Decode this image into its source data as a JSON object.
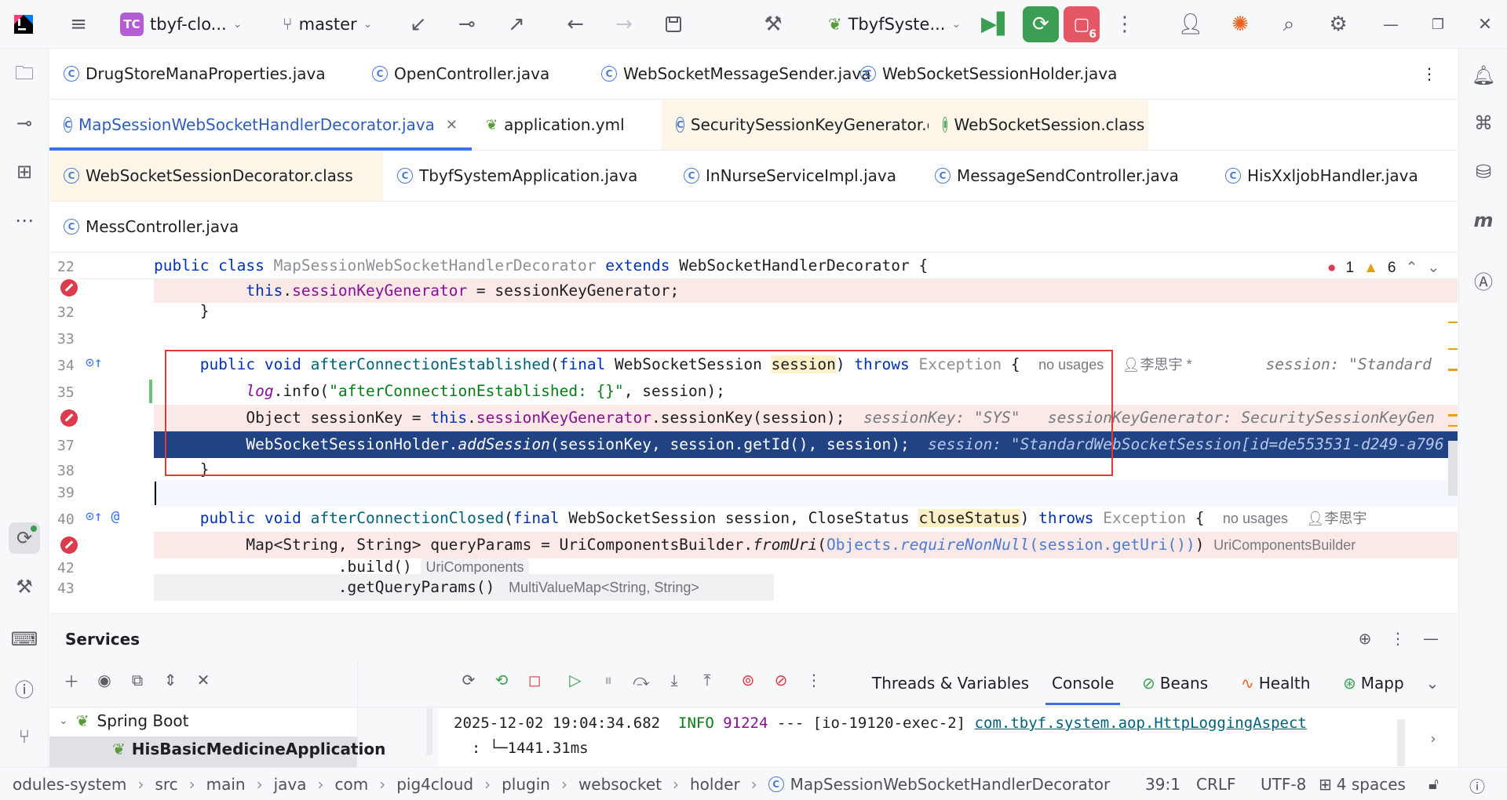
{
  "titlebar": {
    "project_badge": "TC",
    "project_name": "tbyf-clo...",
    "branch": "master",
    "run_config": "TbyfSyste...",
    "notification_count": "6"
  },
  "tabs": {
    "row1": [
      {
        "label": "DrugStoreManaProperties.java",
        "icon": "c"
      },
      {
        "label": "OpenController.java",
        "icon": "c"
      },
      {
        "label": "WebSocketMessageSender.java",
        "icon": "c"
      },
      {
        "label": "WebSocketSessionHolder.java",
        "icon": "c"
      }
    ],
    "row2": [
      {
        "label": "MapSessionWebSocketHandlerDecorator.java",
        "icon": "c"
      },
      {
        "label": "application.yml",
        "icon": "yml"
      },
      {
        "label": "SecuritySessionKeyGenerator.class",
        "icon": "c"
      },
      {
        "label": "WebSocketSession.class",
        "icon": "i"
      }
    ],
    "row3": [
      {
        "label": "WebSocketSessionDecorator.class",
        "icon": "c"
      },
      {
        "label": "TbyfSystemApplication.java",
        "icon": "c"
      },
      {
        "label": "InNurseServiceImpl.java",
        "icon": "c"
      },
      {
        "label": "MessageSendController.java",
        "icon": "c"
      },
      {
        "label": "HisXxljobHandler.java",
        "icon": "c"
      }
    ],
    "row4": [
      {
        "label": "MessController.java",
        "icon": "c"
      }
    ]
  },
  "editor": {
    "problems": {
      "errors": "1",
      "warnings": "6"
    },
    "line_numbers": [
      "22",
      "32",
      "33",
      "34",
      "35",
      "37",
      "38",
      "39",
      "40",
      "42",
      "43"
    ],
    "hints": {
      "no_usages": "no usages",
      "author": "李思宇",
      "author_star": "李思宇 *",
      "inlay_session_34": "session: \"Standard",
      "inlay_sessionkey": "sessionKey: \"SYS\"",
      "inlay_generator": "sessionKeyGenerator: SecuritySessionKeyGen",
      "inlay_session_37": "session: \"StandardWebSocketSession[id=de553531-d249-a796",
      "type_uricomponentsbuilder": "UriComponentsBuilder",
      "type_uricomponents": "UriComponents",
      "type_multivaluemap": "MultiValueMap<String, String>"
    }
  },
  "services": {
    "title": "Services",
    "tree": {
      "root": "Spring Boot",
      "child": "HisBasicMedicineApplication"
    },
    "tabs": [
      "Threads & Variables",
      "Console",
      "Beans",
      "Health",
      "Mapp"
    ],
    "console": {
      "timestamp": "2025-12-02 19:04:34.682",
      "level": "INFO",
      "pid": "91224",
      "sep": "---",
      "thread": "[io-19120-exec-2]",
      "logger": "com.tbyf.system.aop.HttpLoggingAspect",
      "line2": "  : └─1441.31ms"
    }
  },
  "statusbar": {
    "breadcrumbs": [
      "odules-system",
      "src",
      "main",
      "java",
      "com",
      "pig4cloud",
      "plugin",
      "websocket",
      "holder",
      "MapSessionWebSocketHandlerDecorator"
    ],
    "position": "39:1",
    "line_ending": "CRLF",
    "encoding": "UTF-8",
    "indent": "4 spaces"
  },
  "colors": {
    "accent": "#3574f0",
    "selection": "#214283",
    "error_line": "#fbe9e7",
    "highlight_box": "#e53935"
  }
}
